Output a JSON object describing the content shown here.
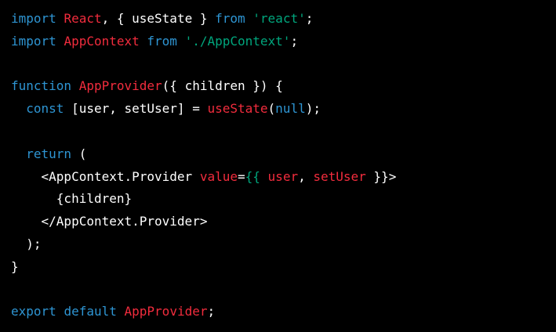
{
  "code": {
    "language": "jsx",
    "colors": {
      "background": "#000000",
      "keyword": "#2e95d3",
      "identifier": "#f22c3d",
      "string": "#00a67d",
      "text": "#ffffff"
    },
    "lines": [
      [
        {
          "t": "import",
          "c": "kw"
        },
        {
          "t": " ",
          "c": "plain"
        },
        {
          "t": "React",
          "c": "fn"
        },
        {
          "t": ", { useState } ",
          "c": "plain"
        },
        {
          "t": "from",
          "c": "kw"
        },
        {
          "t": " ",
          "c": "plain"
        },
        {
          "t": "'react'",
          "c": "str"
        },
        {
          "t": ";",
          "c": "plain"
        }
      ],
      [
        {
          "t": "import",
          "c": "kw"
        },
        {
          "t": " ",
          "c": "plain"
        },
        {
          "t": "AppContext",
          "c": "fn"
        },
        {
          "t": " ",
          "c": "plain"
        },
        {
          "t": "from",
          "c": "kw"
        },
        {
          "t": " ",
          "c": "plain"
        },
        {
          "t": "'./AppContext'",
          "c": "str"
        },
        {
          "t": ";",
          "c": "plain"
        }
      ],
      [],
      [
        {
          "t": "function",
          "c": "kw"
        },
        {
          "t": " ",
          "c": "plain"
        },
        {
          "t": "AppProvider",
          "c": "fn"
        },
        {
          "t": "({ children }) {",
          "c": "plain"
        }
      ],
      [
        {
          "t": "  ",
          "c": "plain"
        },
        {
          "t": "const",
          "c": "kw"
        },
        {
          "t": " [user, setUser] = ",
          "c": "plain"
        },
        {
          "t": "useState",
          "c": "fn"
        },
        {
          "t": "(",
          "c": "plain"
        },
        {
          "t": "null",
          "c": "lit"
        },
        {
          "t": ");",
          "c": "plain"
        }
      ],
      [],
      [
        {
          "t": "  ",
          "c": "plain"
        },
        {
          "t": "return",
          "c": "kw"
        },
        {
          "t": " (",
          "c": "plain"
        }
      ],
      [
        {
          "t": "    <AppContext.Provider ",
          "c": "plain"
        },
        {
          "t": "value",
          "c": "fn"
        },
        {
          "t": "=",
          "c": "plain"
        },
        {
          "t": "{{",
          "c": "brace"
        },
        {
          "t": " ",
          "c": "plain"
        },
        {
          "t": "user",
          "c": "fn"
        },
        {
          "t": ", ",
          "c": "plain"
        },
        {
          "t": "setUser",
          "c": "fn"
        },
        {
          "t": " ",
          "c": "plain"
        },
        {
          "t": "}}",
          "c": "plain"
        },
        {
          "t": ">",
          "c": "plain"
        }
      ],
      [
        {
          "t": "      {children}",
          "c": "plain"
        }
      ],
      [
        {
          "t": "    </AppContext.Provider>",
          "c": "plain"
        }
      ],
      [
        {
          "t": "  );",
          "c": "plain"
        }
      ],
      [
        {
          "t": "}",
          "c": "plain"
        }
      ],
      [],
      [
        {
          "t": "export",
          "c": "kw"
        },
        {
          "t": " ",
          "c": "plain"
        },
        {
          "t": "default",
          "c": "kw"
        },
        {
          "t": " ",
          "c": "plain"
        },
        {
          "t": "AppProvider",
          "c": "fn"
        },
        {
          "t": ";",
          "c": "plain"
        }
      ]
    ]
  }
}
